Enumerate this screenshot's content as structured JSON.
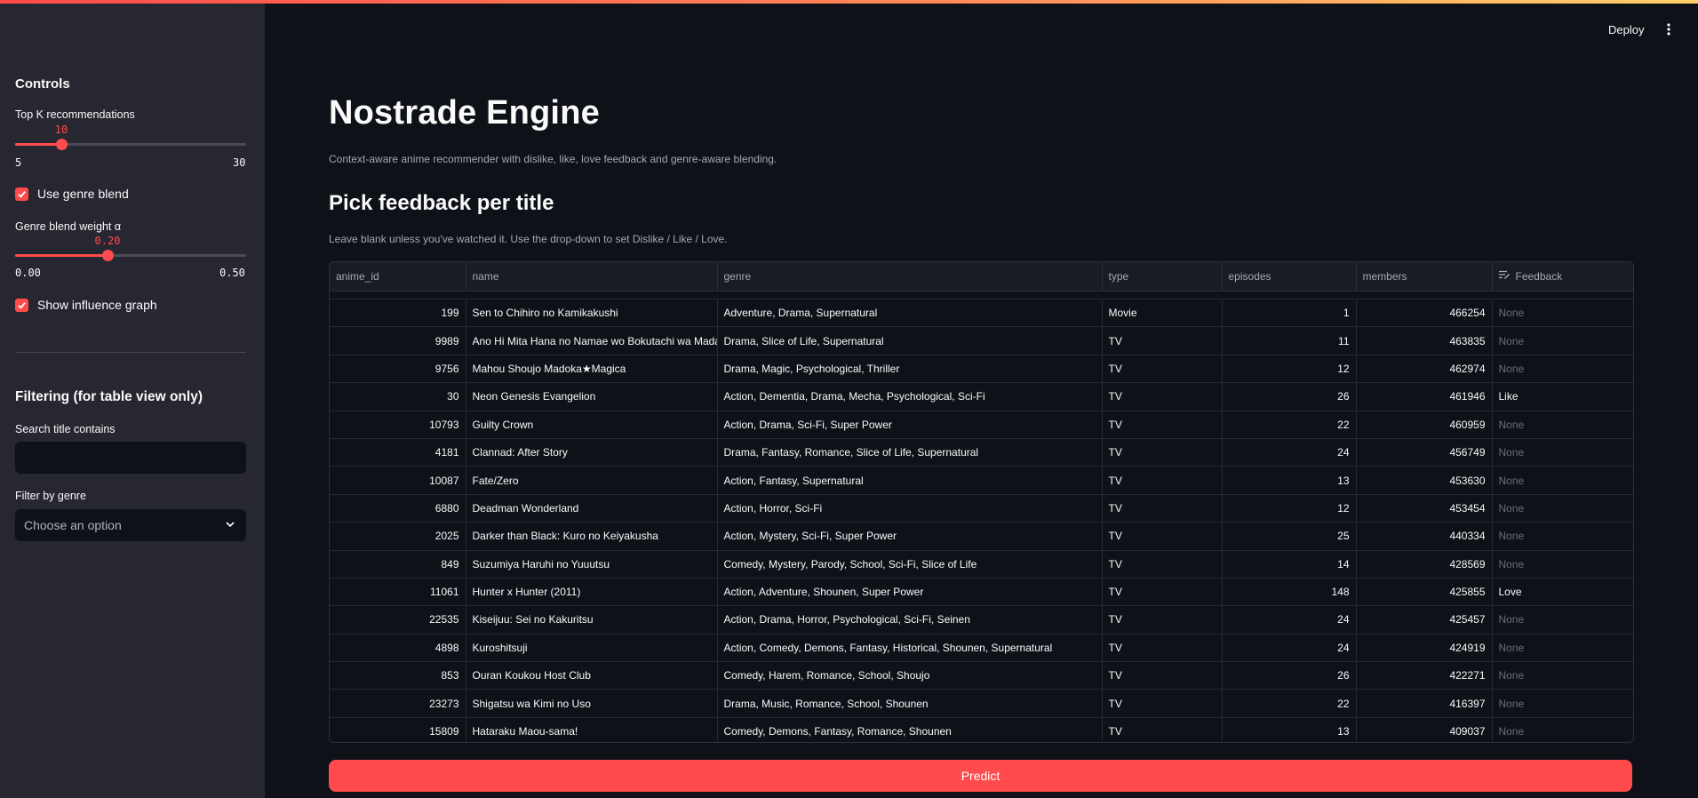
{
  "sidebar": {
    "heading": "Controls",
    "topk": {
      "label": "Top K recommendations",
      "value": "10",
      "min": "5",
      "max": "30",
      "fraction": 0.2
    },
    "genre_blend_checkbox": {
      "label": "Use genre blend",
      "checked": true
    },
    "alpha": {
      "label": "Genre blend weight α",
      "value": "0.20",
      "min": "0.00",
      "max": "0.50",
      "fraction": 0.4
    },
    "influence_checkbox": {
      "label": "Show influence graph",
      "checked": true
    },
    "filter_heading": "Filtering (for table view only)",
    "search": {
      "label": "Search title contains",
      "value": ""
    },
    "genre_filter": {
      "label": "Filter by genre",
      "placeholder": "Choose an option"
    }
  },
  "header": {
    "deploy": "Deploy"
  },
  "main": {
    "title": "Nostrade Engine",
    "subtitle": "Context-aware anime recommender with dislike, like, love feedback and genre-aware blending.",
    "section_title": "Pick feedback per title",
    "caption": "Leave blank unless you've watched it. Use the drop-down to set Dislike / Like / Love.",
    "predict": "Predict"
  },
  "table": {
    "columns": [
      "anime_id",
      "name",
      "genre",
      "type",
      "episodes",
      "members",
      "Feedback"
    ],
    "rows": [
      [
        "199",
        "Sen to Chihiro no Kamikakushi",
        "Adventure, Drama, Supernatural",
        "Movie",
        "1",
        "466254",
        "None"
      ],
      [
        "9989",
        "Ano Hi Mita Hana no Namae wo Bokutachi wa Mada Shiranai.",
        "Drama, Slice of Life, Supernatural",
        "TV",
        "11",
        "463835",
        "None"
      ],
      [
        "9756",
        "Mahou Shoujo Madoka★Magica",
        "Drama, Magic, Psychological, Thriller",
        "TV",
        "12",
        "462974",
        "None"
      ],
      [
        "30",
        "Neon Genesis Evangelion",
        "Action, Dementia, Drama, Mecha, Psychological, Sci-Fi",
        "TV",
        "26",
        "461946",
        "Like"
      ],
      [
        "10793",
        "Guilty Crown",
        "Action, Drama, Sci-Fi, Super Power",
        "TV",
        "22",
        "460959",
        "None"
      ],
      [
        "4181",
        "Clannad: After Story",
        "Drama, Fantasy, Romance, Slice of Life, Supernatural",
        "TV",
        "24",
        "456749",
        "None"
      ],
      [
        "10087",
        "Fate/Zero",
        "Action, Fantasy, Supernatural",
        "TV",
        "13",
        "453630",
        "None"
      ],
      [
        "6880",
        "Deadman Wonderland",
        "Action, Horror, Sci-Fi",
        "TV",
        "12",
        "453454",
        "None"
      ],
      [
        "2025",
        "Darker than Black: Kuro no Keiyakusha",
        "Action, Mystery, Sci-Fi, Super Power",
        "TV",
        "25",
        "440334",
        "None"
      ],
      [
        "849",
        "Suzumiya Haruhi no Yuuutsu",
        "Comedy, Mystery, Parody, School, Sci-Fi, Slice of Life",
        "TV",
        "14",
        "428569",
        "None"
      ],
      [
        "11061",
        "Hunter x Hunter (2011)",
        "Action, Adventure, Shounen, Super Power",
        "TV",
        "148",
        "425855",
        "Love"
      ],
      [
        "22535",
        "Kiseijuu: Sei no Kakuritsu",
        "Action, Drama, Horror, Psychological, Sci-Fi, Seinen",
        "TV",
        "24",
        "425457",
        "None"
      ],
      [
        "4898",
        "Kuroshitsuji",
        "Action, Comedy, Demons, Fantasy, Historical, Shounen, Supernatural",
        "TV",
        "24",
        "424919",
        "None"
      ],
      [
        "853",
        "Ouran Koukou Host Club",
        "Comedy, Harem, Romance, School, Shoujo",
        "TV",
        "26",
        "422271",
        "None"
      ],
      [
        "23273",
        "Shigatsu wa Kimi no Uso",
        "Drama, Music, Romance, School, Shounen",
        "TV",
        "22",
        "416397",
        "None"
      ],
      [
        "15809",
        "Hataraku Maou-sama!",
        "Comedy, Demons, Fantasy, Romance, Shounen",
        "TV",
        "13",
        "409037",
        "None"
      ]
    ]
  },
  "colors": {
    "accent": "#ff4b4b",
    "background": "#0e1117",
    "sidebar": "#262730"
  },
  "icons": {
    "kebab": "more-vertical-icon",
    "chevron": "chevron-down-icon",
    "checkbox": "check-icon",
    "feedback_header": "edit-icon"
  }
}
